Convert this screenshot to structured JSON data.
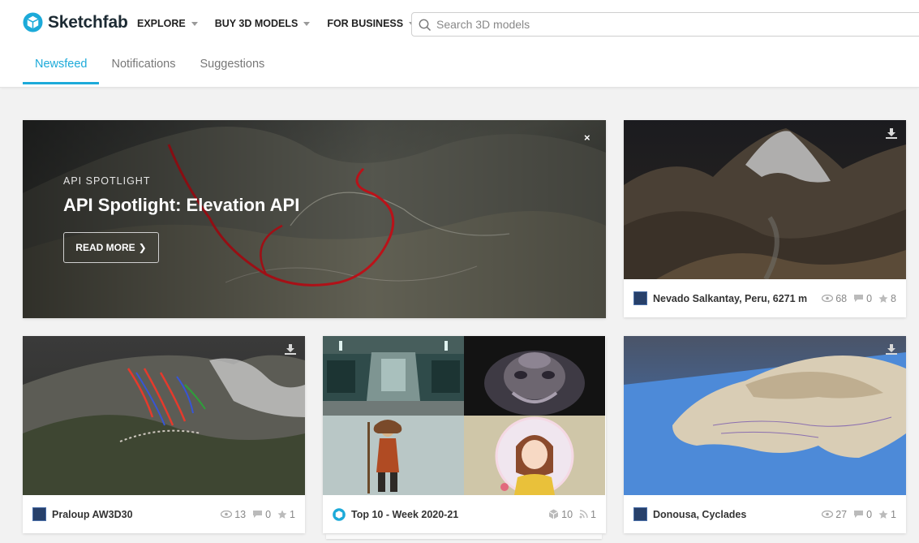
{
  "brand": {
    "name": "Sketchfab",
    "accent": "#1caad9",
    "logo_icon": "sketchfab-cube-icon"
  },
  "topnav": [
    {
      "label": "EXPLORE"
    },
    {
      "label": "BUY 3D MODELS"
    },
    {
      "label": "FOR BUSINESS"
    }
  ],
  "search": {
    "placeholder": "Search 3D models",
    "icon": "search-icon"
  },
  "tabs": [
    {
      "label": "Newsfeed",
      "active": true
    },
    {
      "label": "Notifications",
      "active": false
    },
    {
      "label": "Suggestions",
      "active": false
    }
  ],
  "hero": {
    "eyebrow": "API SPOTLIGHT",
    "title": "API Spotlight: Elevation API",
    "button": "READ MORE",
    "button_icon": "chevron-right-icon",
    "close": "×"
  },
  "cards": [
    {
      "title": "Nevado Salkantay, Peru, 6271 m",
      "views": "68",
      "comments": "0",
      "likes": "8"
    },
    {
      "title": "Praloup AW3D30",
      "views": "13",
      "comments": "0",
      "likes": "1"
    },
    {
      "title": "Top 10 - Week 2020-21",
      "models": "10",
      "followers": "1"
    },
    {
      "title": "Donousa, Cyclades",
      "views": "27",
      "comments": "0",
      "likes": "1"
    }
  ]
}
